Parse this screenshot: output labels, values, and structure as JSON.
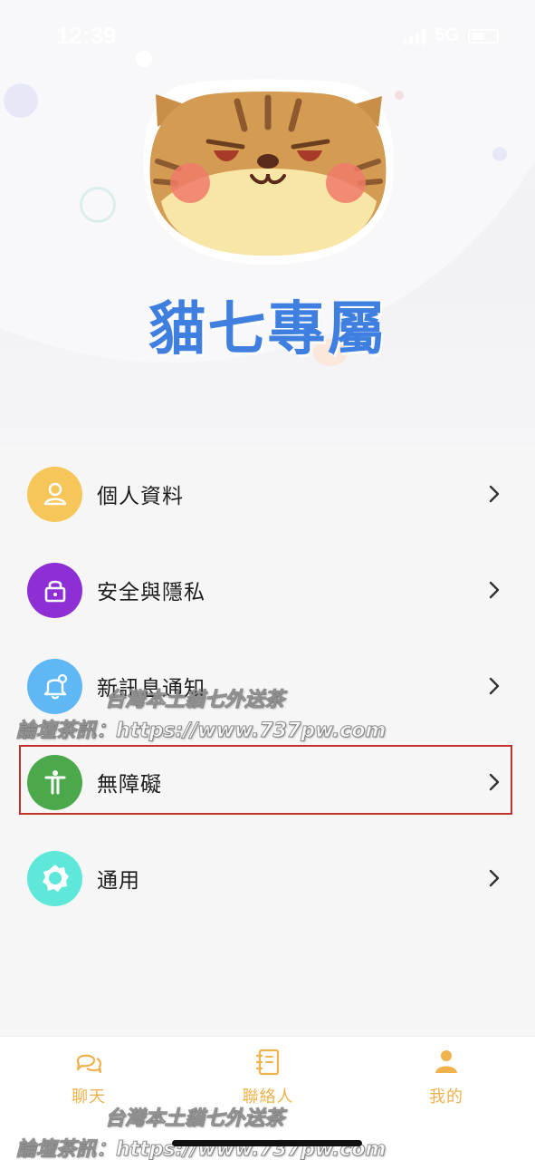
{
  "status_bar": {
    "time": "12:39",
    "network": "5G",
    "battery": "70"
  },
  "brand": {
    "title": "貓七專屬"
  },
  "menu": {
    "items": [
      {
        "label": "個人資料",
        "icon": "person-icon",
        "color": "#f6c65a"
      },
      {
        "label": "安全與隱私",
        "icon": "lock-icon",
        "color": "#8e2fd6"
      },
      {
        "label": "新訊息通知",
        "icon": "bell-icon",
        "color": "#5fb7f5"
      },
      {
        "label": "無障礙",
        "icon": "accessibility-icon",
        "color": "#4ba84b"
      },
      {
        "label": "通用",
        "icon": "gear-icon",
        "color": "#5ee8d9"
      }
    ]
  },
  "watermarks": [
    "台灣本土貓七外送茶",
    "論壇茶訊：https://www.737pw.com",
    "台灣本土貓七外送茶",
    "論壇茶訊：https://www.737pw.com"
  ],
  "tabbar": {
    "tabs": [
      {
        "label": "聊天",
        "icon": "chat-icon"
      },
      {
        "label": "聯絡人",
        "icon": "contacts-icon"
      },
      {
        "label": "我的",
        "icon": "profile-icon",
        "active": true
      }
    ],
    "accent": "#f0b24c"
  }
}
